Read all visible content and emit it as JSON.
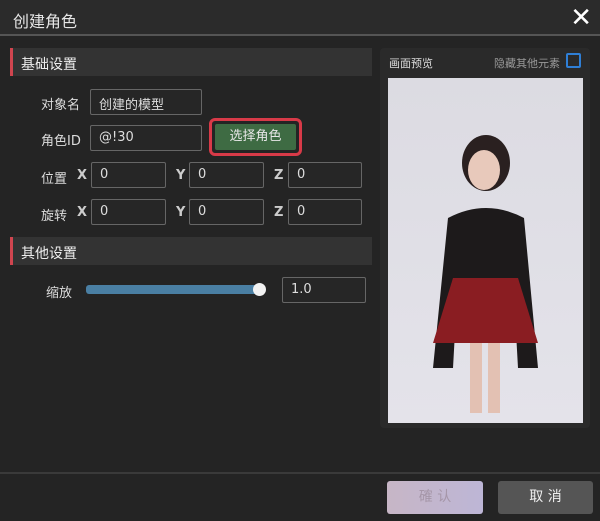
{
  "window": {
    "title": "创建角色"
  },
  "basic": {
    "header": "基础设置",
    "name_label": "对象名",
    "name_value": "创建的模型",
    "id_label": "角色ID",
    "id_value": "@!30",
    "select_button": "选择角色",
    "position_label": "位置",
    "rotation_label": "旋转",
    "x": "X",
    "y": "Y",
    "z": "Z",
    "position": {
      "x": "0",
      "y": "0",
      "z": "0"
    },
    "rotation": {
      "x": "0",
      "y": "0",
      "z": "0"
    }
  },
  "other": {
    "header": "其他设置",
    "scale_label": "缩放",
    "scale_value": "1.0",
    "scale_slider_fraction": 1.0
  },
  "preview": {
    "title": "画面预览",
    "hide_label": "隐藏其他元素"
  },
  "footer": {
    "confirm": "確 认",
    "cancel": "取 消"
  }
}
